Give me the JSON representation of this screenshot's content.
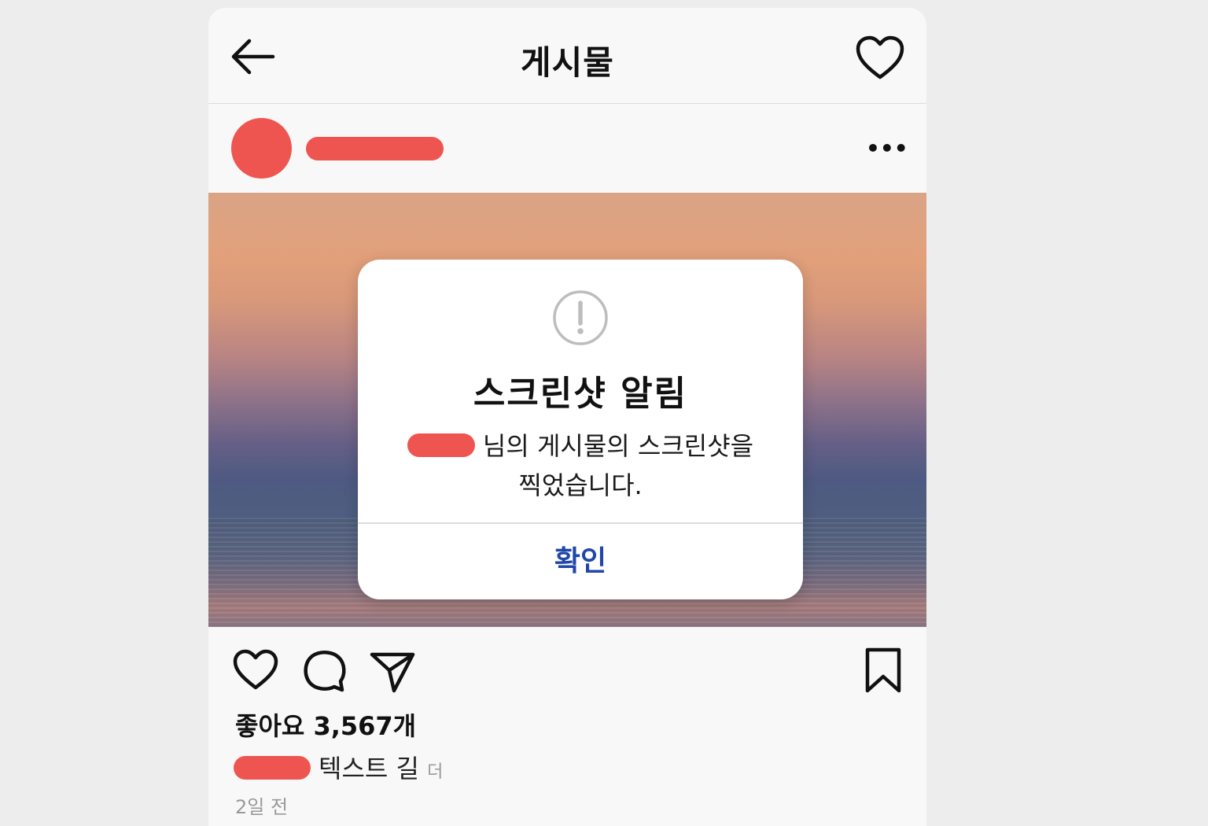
{
  "header": {
    "title": "게시물",
    "back_icon": "arrow-left-icon",
    "heart_icon": "heart-outline-icon"
  },
  "post": {
    "more_icon": "more-horizontal-icon",
    "more_label": "•••",
    "avatar_color": "#ef5550"
  },
  "dialog": {
    "icon": "exclamation-circle-icon",
    "title": "스크린샷 알림",
    "message_line1": "님의 게시물의 스크린샷을",
    "message_line2": "찍었습니다.",
    "confirm_label": "확인",
    "confirm_color": "#2046a8"
  },
  "actions": {
    "like_icon": "heart-outline-icon",
    "comment_icon": "comment-bubble-icon",
    "share_icon": "send-paper-plane-icon",
    "save_icon": "bookmark-icon"
  },
  "likes": "좋아요 3,567개",
  "caption": {
    "text": "텍스트 길",
    "more": "더"
  },
  "time": "2일 전"
}
